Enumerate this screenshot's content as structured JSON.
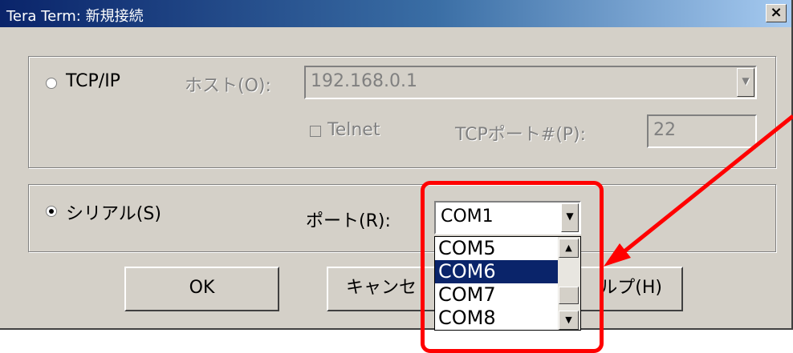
{
  "window": {
    "title": "Tera Term: 新規接続",
    "close_glyph": "×"
  },
  "tcpip": {
    "radio_label": "TCP/IP",
    "host_label": "ホスト(O):",
    "host_value": "192.168.0.1",
    "telnet_label": "Telnet",
    "port_label": "TCPポート#(P):",
    "port_value": "22"
  },
  "serial": {
    "radio_label": "シリアル(S)",
    "port_label": "ポート(R):",
    "port_selected": "COM1",
    "dropdown_items": [
      "COM5",
      "COM6",
      "COM7",
      "COM8"
    ],
    "selected_index": 1
  },
  "buttons": {
    "ok": "OK",
    "cancel": "キャンセ",
    "help": "ルプ(H)"
  },
  "icons": {
    "dropdown": "▼",
    "scroll_up": "▲",
    "scroll_down": "▼"
  },
  "colors": {
    "highlight": "#ff0000",
    "selection": "#0a246a"
  }
}
